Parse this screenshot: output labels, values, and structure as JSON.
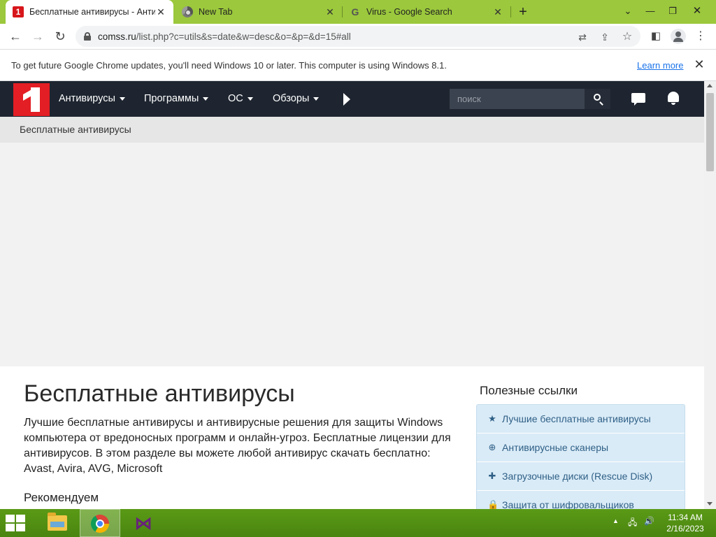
{
  "browser": {
    "tabs": [
      {
        "title": "Бесплатные антивирусы - Анти",
        "favicon": "comss-favicon-icon",
        "active": true
      },
      {
        "title": "New Tab",
        "favicon": "chrome-favicon-icon",
        "active": false
      },
      {
        "title": "Virus - Google Search",
        "favicon": "google-favicon-icon",
        "active": false
      }
    ],
    "url_host": "comss.ru",
    "url_path": "/list.php?c=utils&s=date&w=desc&o=&p=&d=15#all",
    "accent_color": "#9bc83c"
  },
  "infobar": {
    "message": "To get future Google Chrome updates, you'll need Windows 10 or later. This computer is using Windows 8.1.",
    "link": "Learn more"
  },
  "site": {
    "logo_glyph": "1",
    "nav": [
      {
        "label": "Антивирусы"
      },
      {
        "label": "Программы"
      },
      {
        "label": "ОС"
      },
      {
        "label": "Обзоры"
      }
    ],
    "search_placeholder": "поиск",
    "nav_bg_color": "#1e2530",
    "brand_color": "#e31e24"
  },
  "breadcrumb": "Бесплатные антивирусы",
  "main": {
    "title": "Бесплатные антивирусы",
    "intro": "Лучшие бесплатные антивирусы и антивирусные решения для защиты Windows компьютера от вредоносных программ и онлайн-угроз. Бесплатные лицензии для антивирусов. В этом разделе вы можете любой антивирус скачать бесплатно: Avast, Avira, AVG, Microsoft",
    "recommend": "Рекомендуем"
  },
  "sidebar": {
    "title": "Полезные ссылки",
    "links": [
      {
        "icon": "star-icon",
        "glyph": "★",
        "label": "Лучшие бесплатные антивирусы"
      },
      {
        "icon": "magnifier-plus-icon",
        "glyph": "⊕",
        "label": "Антивирусные сканеры"
      },
      {
        "icon": "plus-circle-icon",
        "glyph": "✚",
        "label": "Загрузочные диски (Rescue Disk)"
      },
      {
        "icon": "lock-icon",
        "glyph": "🔒",
        "label": "Защита от шифровальщиков"
      }
    ]
  },
  "taskbar": {
    "time": "11:34 AM",
    "date": "2/16/2023",
    "color": "#4f8a10"
  }
}
